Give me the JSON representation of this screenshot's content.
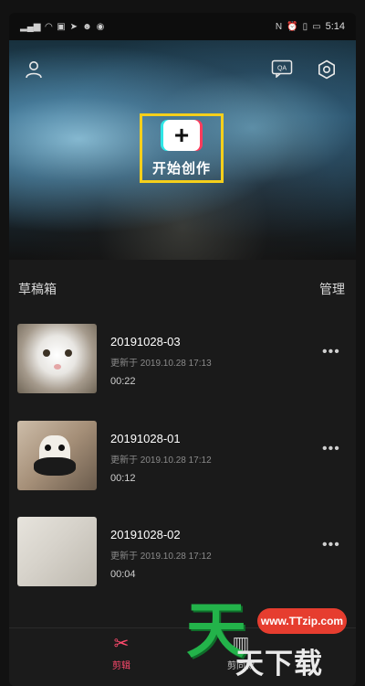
{
  "status_bar": {
    "left_icons": [
      "signal-icon",
      "wifi-icon",
      "notification-icon",
      "telegram-icon",
      "qq-icon",
      "chat-icon"
    ],
    "right_icons": [
      "nfc-icon",
      "alarm-icon",
      "vibrate-icon",
      "battery-icon"
    ],
    "time": "5:14"
  },
  "hero": {
    "top_icons": [
      "profile-icon",
      "qa-icon",
      "settings-icon"
    ],
    "create_label": "开始创作"
  },
  "drafts": {
    "section_title": "草稿箱",
    "manage_label": "管理",
    "items": [
      {
        "title": "20191028-03",
        "updated": "更新于 2019.10.28 17:13",
        "duration": "00:22",
        "thumb": "cat"
      },
      {
        "title": "20191028-01",
        "updated": "更新于 2019.10.28 17:12",
        "duration": "00:12",
        "thumb": "panda"
      },
      {
        "title": "20191028-02",
        "updated": "更新于 2019.10.28 17:12",
        "duration": "00:04",
        "thumb": "cloth"
      }
    ],
    "more_label": "•••"
  },
  "tabbar": {
    "edit_label": "剪辑",
    "template_label": "剪同款"
  },
  "watermark": {
    "logo_char": "天",
    "site": "www.TTzip.com",
    "name": "天下载"
  },
  "colors": {
    "accent": "#ff4a6d",
    "highlight": "#f5cf1b",
    "watermark_green": "#23b34a",
    "watermark_red": "#e63d2f"
  }
}
